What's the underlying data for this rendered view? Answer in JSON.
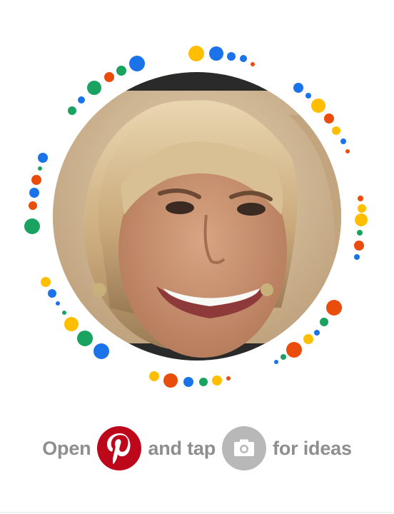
{
  "pincode": {
    "avatar_label": "Profile photo",
    "dot_colors": [
      "#ffbf00",
      "#1a73e8",
      "#ea4c0c",
      "#1aa260",
      "#0b8043"
    ]
  },
  "instructions": {
    "open": "Open",
    "and_tap": "and tap",
    "for_ideas": "for ideas",
    "pinterest_icon": "pinterest-logo-icon",
    "camera_icon": "camera-icon"
  },
  "colors": {
    "pinterest_red": "#bd081c",
    "camera_gray": "#b8b8b8",
    "text_gray": "#8e8e8e"
  }
}
